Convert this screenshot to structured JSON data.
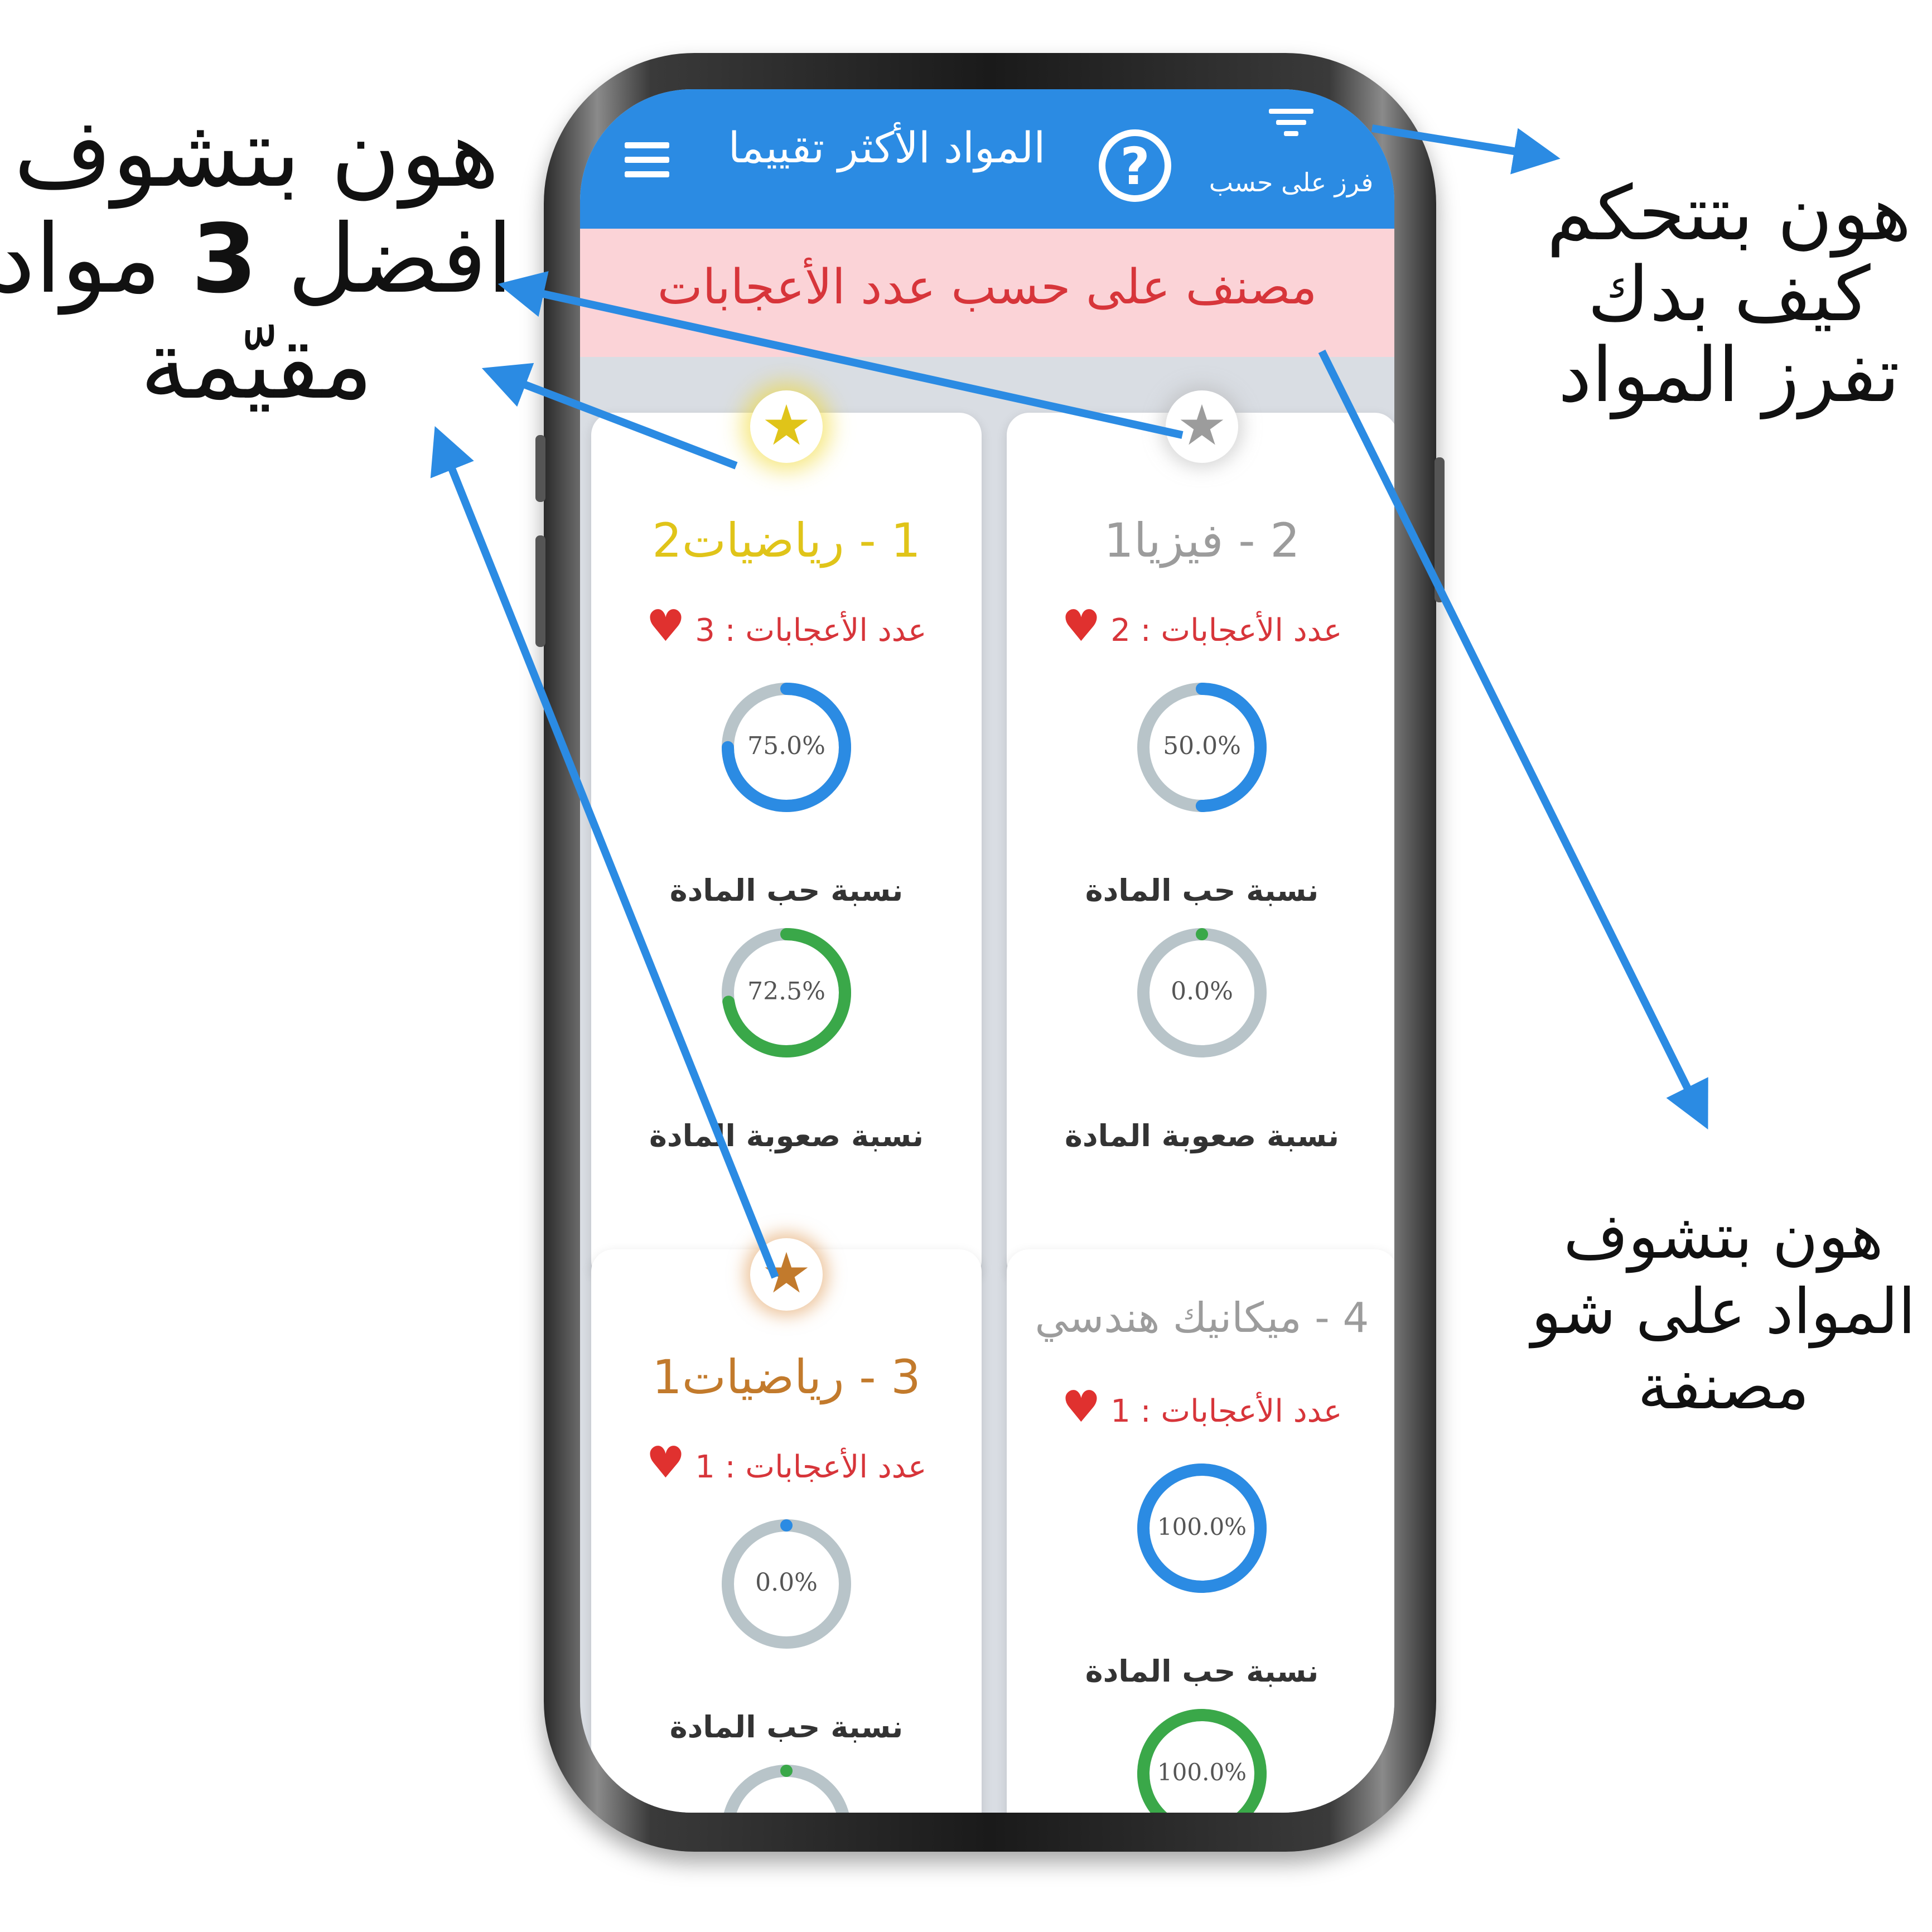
{
  "annotations": {
    "left": {
      "line1": "هون بتشوف",
      "line2_pre": "افضل ",
      "line2_num": "3",
      "line2_post": " مواد",
      "line3": "مقيّمة"
    },
    "right_top": {
      "line1": "هون بتتحكم",
      "line2": "كيف بدك",
      "line3": "تفرز المواد"
    },
    "right_bottom": {
      "line1": "هون بتشوف",
      "line2": "المواد على شو",
      "line3": "مصنفة"
    }
  },
  "app": {
    "title": "المواد الأكثر تقييما",
    "sort_label": "فرز على حسب",
    "help_symbol": "?",
    "banner": "مصنف على حسب عدد الأعجابات"
  },
  "cards": [
    {
      "title": "1 - رياضيات2",
      "likes_label": "عدد الأعجابات : 3",
      "love_pct": "75.0%",
      "love_label": "نسبة حب المادة",
      "diff_pct": "72.5%",
      "diff_label": "نسبة صعوبة المادة"
    },
    {
      "title": "2 - فيزيا1",
      "likes_label": "عدد الأعجابات : 2",
      "love_pct": "50.0%",
      "love_label": "نسبة حب المادة",
      "diff_pct": "0.0%",
      "diff_label": "نسبة صعوبة المادة"
    },
    {
      "title": "3 - رياضيات1",
      "likes_label": "عدد الأعجابات : 1",
      "love_pct": "0.0%",
      "love_label": "نسبة حب المادة"
    },
    {
      "title": "4 - ميكانيك هندسي",
      "likes_label": "عدد الأعجابات : 1",
      "love_pct": "100.0%",
      "love_label": "نسبة حب المادة",
      "diff_pct": "100.0%"
    }
  ],
  "colors": {
    "appbar": "#2b8be3",
    "banner_bg": "#fbd3d7",
    "banner_text": "#d7353a",
    "gold": "#e0c419",
    "silver": "#9c9c9c",
    "bronze": "#c27a2c",
    "love_ring": "#2b8be3",
    "difficulty_ring": "#3aa849",
    "ring_track": "#b8c4c9",
    "arrow": "#2b8be3"
  },
  "icons": {
    "menu": "menu-icon",
    "help": "help-icon",
    "sort": "filter-icon",
    "medal": "star-icon",
    "like": "heart-icon"
  }
}
